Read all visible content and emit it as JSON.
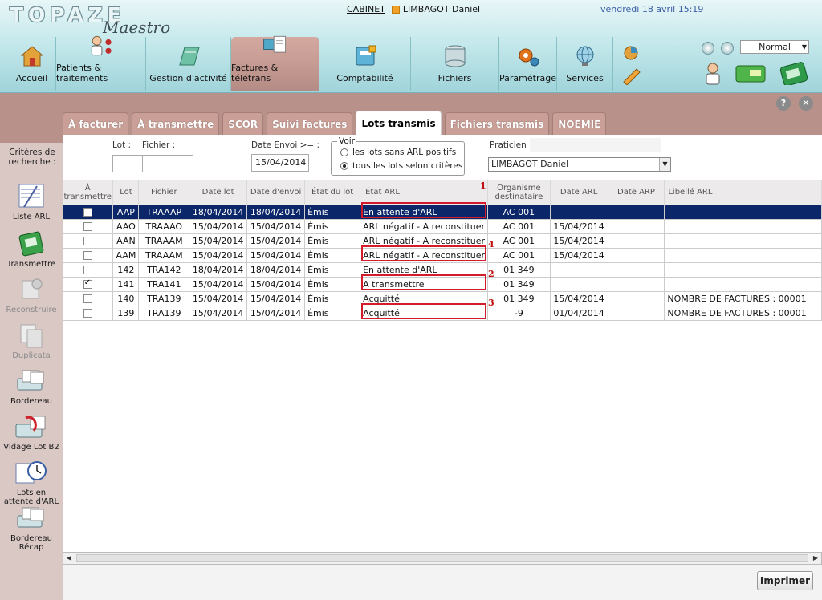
{
  "app": {
    "logo": "TOPAZE",
    "logo_sub": "Maestro",
    "cabinet_label": "CABINET",
    "user": "LIMBAGOT Daniel",
    "datetime": "vendredi 18 avril 15:19",
    "zoom": "Normal"
  },
  "nav": [
    {
      "label": "Accueil",
      "icon": "home-icon",
      "active": false
    },
    {
      "label": "Patients & traitements",
      "icon": "patients-icon",
      "active": false
    },
    {
      "label": "Gestion d'activité",
      "icon": "activity-icon",
      "active": false
    },
    {
      "label": "Factures & télétrans",
      "icon": "invoices-icon",
      "active": true
    },
    {
      "label": "Comptabilité",
      "icon": "accounting-icon",
      "active": false
    },
    {
      "label": "Fichiers",
      "icon": "files-icon",
      "active": false
    },
    {
      "label": "Paramétrage",
      "icon": "settings-icon",
      "active": false
    },
    {
      "label": "Services",
      "icon": "globe-icon",
      "active": false
    }
  ],
  "tabs": [
    "À facturer",
    "À transmettre",
    "SCOR",
    "Suivi factures",
    "Lots transmis",
    "Fichiers transmis",
    "NOEMIE"
  ],
  "active_tab": 4,
  "sidebar": {
    "criteria_label": "Critères de recherche :",
    "buttons": [
      {
        "label": "Liste ARL",
        "icon": "list-arl-icon",
        "disabled": false
      },
      {
        "label": "Transmettre",
        "icon": "transmit-icon",
        "disabled": false
      },
      {
        "label": "Reconstruire",
        "icon": "rebuild-icon",
        "disabled": true
      },
      {
        "label": "Duplicata",
        "icon": "duplicate-icon",
        "disabled": true
      },
      {
        "label": "Bordereau",
        "icon": "bordereau-icon",
        "disabled": false
      },
      {
        "label": "Vidage Lot B2",
        "icon": "empty-lot-icon",
        "disabled": false
      },
      {
        "label": "Lots en attente d'ARL",
        "icon": "clock-icon",
        "disabled": false
      },
      {
        "label": "Bordereau Récap",
        "icon": "bordereau-recap-icon",
        "disabled": false
      }
    ]
  },
  "criteria": {
    "lot_label": "Lot :",
    "lot_value": "",
    "fichier_label": "Fichier :",
    "fichier_value": "",
    "date_envoi_label": "Date Envoi >= :",
    "date_envoi_value": "15/04/2014",
    "voir_label": "Voir",
    "voir_options": [
      "les lots sans ARL positifs",
      "tous les lots selon critères"
    ],
    "voir_selected": 1,
    "praticien_label": "Praticien :",
    "praticien_value": "LIMBAGOT Daniel"
  },
  "table": {
    "columns": [
      "À transmettre",
      "Lot",
      "Fichier",
      "Date lot",
      "Date d'envoi",
      "État du lot",
      "État ARL",
      "Organisme destinataire",
      "Date ARL",
      "Date ARP",
      "Libellé ARL"
    ],
    "rows": [
      {
        "checked": false,
        "lot": "AAP",
        "fichier": "TRAAAP",
        "date_lot": "18/04/2014",
        "date_envoi": "18/04/2014",
        "etat_lot": "Émis",
        "etat_arl": "En attente d'ARL",
        "organisme": "AC 001",
        "date_arl": "",
        "date_arp": "",
        "libelle": ""
      },
      {
        "checked": false,
        "lot": "AAO",
        "fichier": "TRAAAO",
        "date_lot": "15/04/2014",
        "date_envoi": "15/04/2014",
        "etat_lot": "Émis",
        "etat_arl": "ARL négatif - A reconstituer",
        "organisme": "AC 001",
        "date_arl": "15/04/2014",
        "date_arp": "",
        "libelle": ""
      },
      {
        "checked": false,
        "lot": "AAN",
        "fichier": "TRAAAM",
        "date_lot": "15/04/2014",
        "date_envoi": "15/04/2014",
        "etat_lot": "Émis",
        "etat_arl": "ARL négatif - A reconstituer",
        "organisme": "AC 001",
        "date_arl": "15/04/2014",
        "date_arp": "",
        "libelle": ""
      },
      {
        "checked": false,
        "lot": "AAM",
        "fichier": "TRAAAM",
        "date_lot": "15/04/2014",
        "date_envoi": "15/04/2014",
        "etat_lot": "Émis",
        "etat_arl": "ARL négatif - A reconstituer",
        "organisme": "AC 001",
        "date_arl": "15/04/2014",
        "date_arp": "",
        "libelle": ""
      },
      {
        "checked": false,
        "lot": "142",
        "fichier": "TRA142",
        "date_lot": "18/04/2014",
        "date_envoi": "18/04/2014",
        "etat_lot": "Émis",
        "etat_arl": "En attente d'ARL",
        "organisme": "01 349",
        "date_arl": "",
        "date_arp": "",
        "libelle": ""
      },
      {
        "checked": true,
        "lot": "141",
        "fichier": "TRA141",
        "date_lot": "15/04/2014",
        "date_envoi": "15/04/2014",
        "etat_lot": "Émis",
        "etat_arl": "A transmettre",
        "organisme": "01 349",
        "date_arl": "",
        "date_arp": "",
        "libelle": ""
      },
      {
        "checked": false,
        "lot": "140",
        "fichier": "TRA139",
        "date_lot": "15/04/2014",
        "date_envoi": "15/04/2014",
        "etat_lot": "Émis",
        "etat_arl": "Acquitté",
        "organisme": "01 349",
        "date_arl": "15/04/2014",
        "date_arp": "",
        "libelle": "NOMBRE DE FACTURES : 00001"
      },
      {
        "checked": false,
        "lot": "139",
        "fichier": "TRA139",
        "date_lot": "15/04/2014",
        "date_envoi": "15/04/2014",
        "etat_lot": "Émis",
        "etat_arl": "Acquitté",
        "organisme": "-9",
        "date_arl": "01/04/2014",
        "date_arp": "",
        "libelle": "NOMBRE DE FACTURES : 00001"
      }
    ],
    "selected_row": 0
  },
  "annotations": [
    "1",
    "4",
    "2",
    "3"
  ],
  "print_label": "Imprimer",
  "colors": {
    "selected_row": "#0c2769",
    "annotation_red": "#d21c2c",
    "accent_teal": "#9fd4da",
    "body_bg": "#b8918a"
  }
}
